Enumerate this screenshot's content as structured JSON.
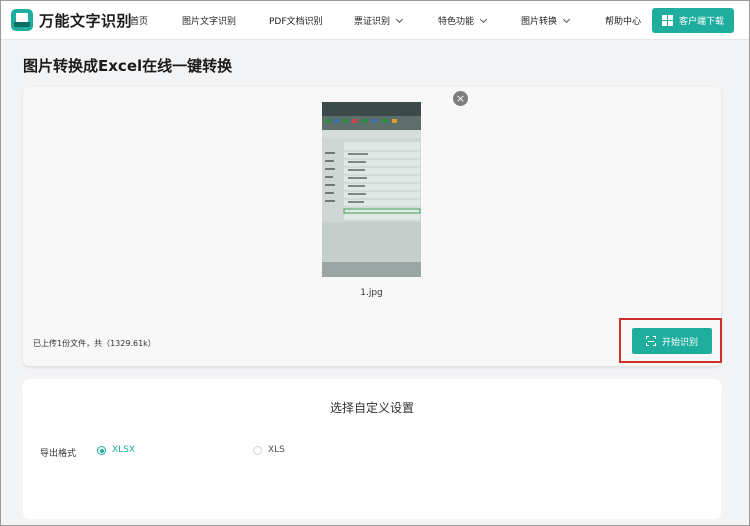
{
  "header": {
    "brand": "万能文字识别",
    "nav": [
      {
        "label": "首页"
      },
      {
        "label": "图片文字识别"
      },
      {
        "label": "PDF文档识别"
      },
      {
        "label": "票证识别"
      },
      {
        "label": "特色功能"
      },
      {
        "label": "图片转换"
      },
      {
        "label": "帮助中心"
      }
    ],
    "download_label": "客户端下载"
  },
  "page_title": "图片转换成Excel在线一键转换",
  "upload": {
    "filename": "1.jpg",
    "info": "已上传1份文件，共（1329.61k）",
    "remove_symbol": "×",
    "start_label": "开始识别"
  },
  "settings": {
    "title": "选择自定义设置",
    "export_label": "导出格式",
    "options": [
      {
        "label": "XLSX",
        "selected": true
      },
      {
        "label": "XLS",
        "selected": false
      }
    ]
  },
  "colors": {
    "accent": "#1fae9e",
    "highlight": "#d0302b"
  }
}
